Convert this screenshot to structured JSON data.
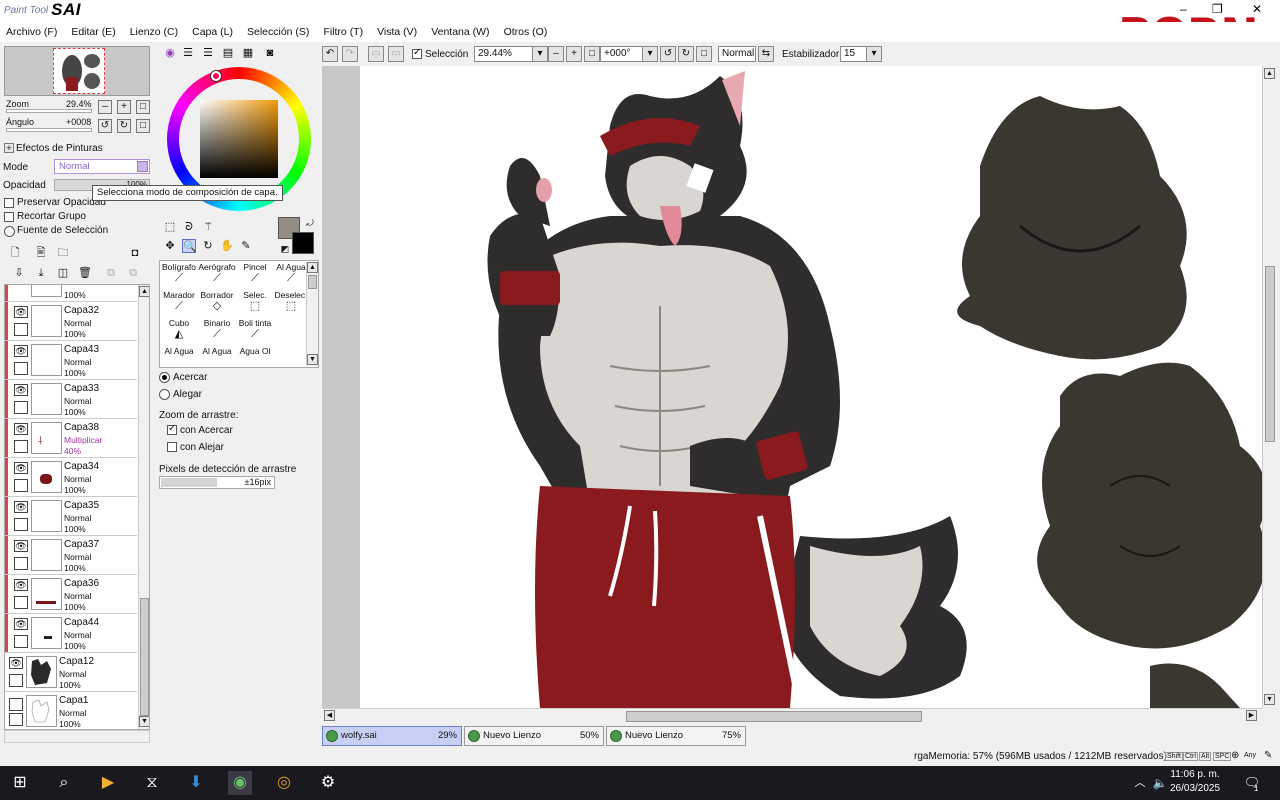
{
  "app": {
    "logo_small": "Paint Tool",
    "logo_big": "SAI",
    "watermark": "PORN"
  },
  "menu": [
    "Archivo (F)",
    "Editar (E)",
    "Lienzo (C)",
    "Capa (L)",
    "Selección (S)",
    "Filtro (T)",
    "Vista (V)",
    "Ventana (W)",
    "Otros (O)"
  ],
  "navigator": {
    "zoom_label": "Zoom",
    "zoom_value": "29.4%",
    "angle_label": "Ángulo",
    "angle_value": "+0008"
  },
  "layer_props": {
    "effects_label": "Efectos de Pinturas",
    "mode_label": "Mode",
    "mode_value": "Normal",
    "opacity_label": "Opacidad",
    "opacity_value": "100%",
    "preserve_opacity": "Preservar Opacidad",
    "clip_group": "Recortar Grupo",
    "selection_source": "Fuente de Selección",
    "tooltip": "Selecciona modo de composición de capa."
  },
  "layers": [
    {
      "name": "",
      "mode": "",
      "opacity": "100%"
    },
    {
      "name": "Capa32",
      "mode": "Normal",
      "opacity": "100%"
    },
    {
      "name": "Capa43",
      "mode": "Normal",
      "opacity": "100%"
    },
    {
      "name": "Capa33",
      "mode": "Normal",
      "opacity": "100%"
    },
    {
      "name": "Capa38",
      "mode": "Multiplicar",
      "opacity": "40%"
    },
    {
      "name": "Capa34",
      "mode": "Normal",
      "opacity": "100%"
    },
    {
      "name": "Capa35",
      "mode": "Normal",
      "opacity": "100%"
    },
    {
      "name": "Capa37",
      "mode": "Normal",
      "opacity": "100%"
    },
    {
      "name": "Capa36",
      "mode": "Normal",
      "opacity": "100%"
    },
    {
      "name": "Capa44",
      "mode": "Normal",
      "opacity": "100%"
    },
    {
      "name": "Capa12",
      "mode": "Normal",
      "opacity": "100%"
    },
    {
      "name": "Capa1",
      "mode": "Normal",
      "opacity": "100%"
    }
  ],
  "tools": [
    {
      "label": "Bolígrafo",
      "icon": "pen-icon"
    },
    {
      "label": "Aerógrafo",
      "icon": "airbrush-icon"
    },
    {
      "label": "Pincel",
      "icon": "brush-icon"
    },
    {
      "label": "Al Agua",
      "icon": "water-icon"
    },
    {
      "label": "Marador",
      "icon": "marker-icon"
    },
    {
      "label": "Borrador",
      "icon": "eraser-icon"
    },
    {
      "label": "Selec.",
      "icon": "select-icon"
    },
    {
      "label": "Deselec.",
      "icon": "deselect-icon"
    },
    {
      "label": "Cubo",
      "icon": "bucket-icon"
    },
    {
      "label": "Binario",
      "icon": "binary-icon"
    },
    {
      "label": "Boli tinta",
      "icon": "ink-icon"
    },
    {
      "label": "",
      "icon": ""
    },
    {
      "label": "Al Agua",
      "icon": ""
    },
    {
      "label": "Al Agua",
      "icon": ""
    },
    {
      "label": "Agua Ol",
      "icon": ""
    },
    {
      "label": "",
      "icon": ""
    }
  ],
  "zoom_tool": {
    "zoom_in": "Acercar",
    "zoom_out": "Alegar",
    "drag_zoom_label": "Zoom de arrastre:",
    "with_zoom_in": "con Acercar",
    "with_zoom_out": "con Alejar",
    "drag_pixels_label": "Pixels de detección de arrastre",
    "drag_pixels_value": "±16pix"
  },
  "canvas_toolbar": {
    "selection_label": "Selección",
    "zoom": "29.44%",
    "angle": "+000°",
    "mode": "Normal",
    "stabilizer_label": "Estabilizador",
    "stabilizer_value": "15"
  },
  "doc_tabs": [
    {
      "name": "wolfy.sai",
      "zoom": "29%"
    },
    {
      "name": "Nuevo Lienzo",
      "zoom": "50%"
    },
    {
      "name": "Nuevo Lienzo",
      "zoom": "75%"
    }
  ],
  "status": {
    "memory": "rgaMemoria: 57% (596MB usados / 1212MB reservados)",
    "keys": [
      "Shift",
      "Ctrl",
      "Alt",
      "SPC",
      "Any"
    ]
  },
  "taskbar": {
    "time": "11:06 p. m.",
    "date": "26/03/2025",
    "notifications": "1"
  },
  "colors": {
    "accent_layer": "#dd4444",
    "multiply_mode": "#a033a0",
    "fur_dark": "#2e2c2c",
    "fur_light": "#d9d6d2",
    "pants": "#8a1a1e",
    "sketch": "#3a3630"
  }
}
